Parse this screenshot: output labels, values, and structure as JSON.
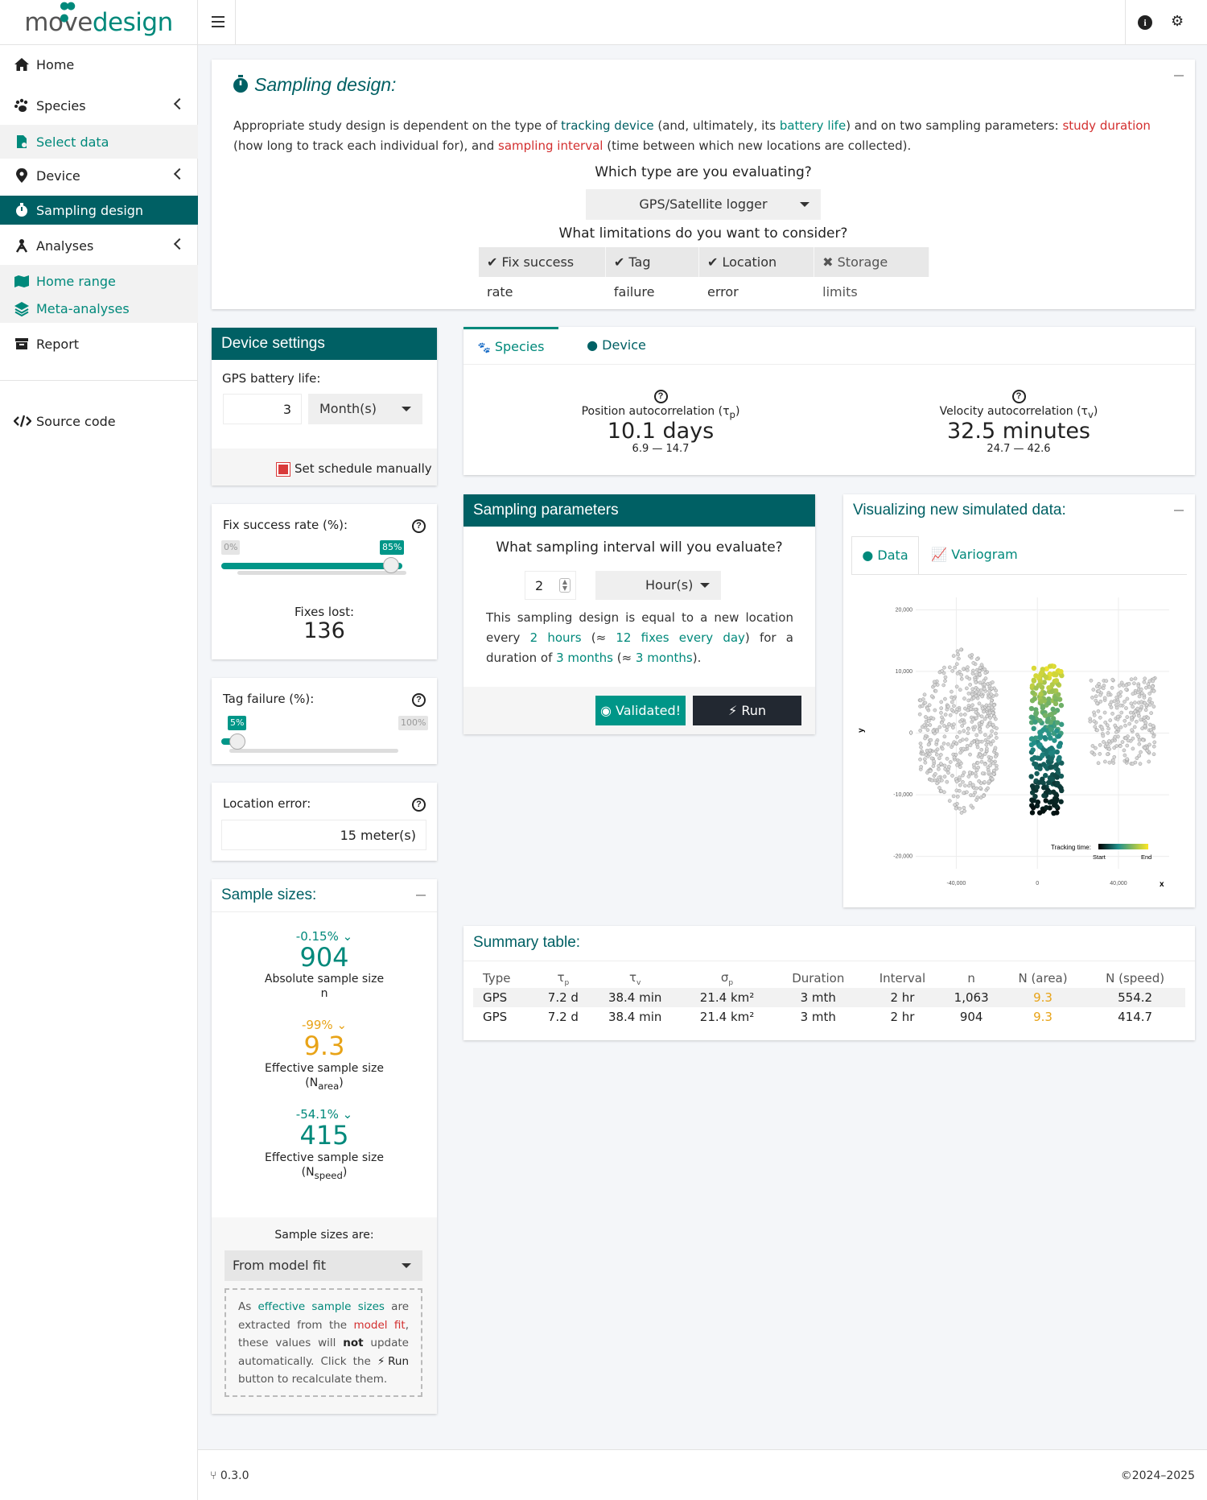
{
  "brand": {
    "part1": "move",
    "part2": "design"
  },
  "sidebar": {
    "home": "Home",
    "species": "Species",
    "select_data": "Select data",
    "device": "Device",
    "sampling_design": "Sampling design",
    "analyses": "Analyses",
    "home_range": "Home range",
    "meta_analyses": "Meta-analyses",
    "report": "Report",
    "source_code": "Source code"
  },
  "intro": {
    "title": "Sampling design:",
    "text1": "Appropriate study design is dependent on the type of ",
    "tracking_device": "tracking device",
    "text2": " (and, ultimately, its ",
    "battery_life": "battery life",
    "text3": ") and on two sampling parameters: ",
    "study_duration": "study duration",
    "text4": " (how long to track each individual for), and ",
    "sampling_interval": "sampling interval",
    "text5": " (time between which new locations are collected).",
    "q_type": "Which type are you evaluating?",
    "type_value": "GPS/Satellite logger",
    "q_limits": "What limitations do you want to consider?",
    "limits": [
      {
        "label": "Fix success rate",
        "mark": "✔"
      },
      {
        "label": "Tag failure",
        "mark": "✔"
      },
      {
        "label": "Location error",
        "mark": "✔"
      },
      {
        "label": "Storage limits",
        "mark": "✖"
      }
    ]
  },
  "device_settings": {
    "title": "Device settings",
    "battery_label": "GPS battery life:",
    "battery_value": "3",
    "battery_unit": "Month(s)",
    "schedule_label": "Set schedule manually"
  },
  "fix_success": {
    "label": "Fix success rate (%):",
    "min": "0%",
    "value": "85%",
    "value_num": 85,
    "fixes_lost_label": "Fixes lost:",
    "fixes_lost": "136"
  },
  "tag_failure": {
    "label": "Tag failure (%):",
    "value": "5%",
    "value_num": 5,
    "max": "100%"
  },
  "location_error": {
    "label": "Location error:",
    "value": "15 meter(s)"
  },
  "sample_sizes": {
    "title": "Sample sizes:",
    "abs_change": "-0.15%",
    "abs_value": "904",
    "abs_label": "Absolute sample size",
    "abs_sym": "n",
    "area_change": "-99%",
    "area_value": "9.3",
    "area_label": "Effective sample size",
    "area_sym": "N",
    "area_sub": "area",
    "speed_change": "-54.1%",
    "speed_value": "415",
    "speed_label": "Effective sample size",
    "speed_sym": "N",
    "speed_sub": "speed",
    "are_label": "Sample sizes are:",
    "are_value": "From model fit",
    "note1": "As ",
    "note_ess": "effective sample sizes",
    "note2": " are extracted from the ",
    "note_model": "model fit",
    "note3": ", these values will ",
    "note_not": "not",
    "note4": " update automatically. Click the ",
    "note_run": "Run",
    "note5": " button to recalculate them."
  },
  "tabs": {
    "species": "Species",
    "device": "Device"
  },
  "autocorr": {
    "pos_label": "Position autocorrelation (τ",
    "pos_sub": "p",
    "pos_close": ")",
    "pos_value": "10.1 days",
    "pos_range": "6.9 — 14.7",
    "vel_label": "Velocity autocorrelation (τ",
    "vel_sub": "v",
    "vel_close": ")",
    "vel_value": "32.5 minutes",
    "vel_range": "24.7 — 42.6"
  },
  "sampling": {
    "title": "Sampling parameters",
    "question": "What sampling interval will you evaluate?",
    "interval_value": "2",
    "interval_unit": "Hour(s)",
    "t1": "This sampling design is equal to a new location every ",
    "every": "2 hours",
    "t2": " (≈ ",
    "fixes": "12 fixes every day",
    "t3": ") for a duration of ",
    "duration": "3 months",
    "t4": " (≈ ",
    "duration2": "3 months",
    "t5": ").",
    "validated": "Validated!",
    "run": "Run"
  },
  "viz": {
    "title": "Visualizing new simulated data:",
    "tab_data": "Data",
    "tab_variogram": "Variogram"
  },
  "chart_data": {
    "type": "scatter",
    "xlabel": "x",
    "ylabel": "y",
    "xticks": [
      "-40,000",
      "0",
      "40,000"
    ],
    "yticks": [
      "20,000",
      "10,000",
      "0",
      "-10,000",
      "-20,000"
    ],
    "xlim": [
      -60000,
      65000
    ],
    "ylim": [
      -22000,
      22000
    ],
    "legend": {
      "title": "Tracking time:",
      "start": "Start",
      "end": "End"
    },
    "colors": {
      "start": "#000000",
      "mid": "#21918c",
      "end": "#fde725",
      "reference": "#9e9e9e"
    },
    "series": [
      {
        "name": "reference",
        "region": "west",
        "x_range": [
          -58000,
          -20000
        ],
        "y_range": [
          -13000,
          14000
        ]
      },
      {
        "name": "reference",
        "region": "east",
        "x_range": [
          26000,
          58000
        ],
        "y_range": [
          -5000,
          9000
        ]
      },
      {
        "name": "simulated",
        "x_range": [
          -3000,
          12000
        ],
        "y_range": [
          -13000,
          11000
        ]
      }
    ]
  },
  "summary": {
    "title": "Summary table:",
    "headers": [
      "Type",
      "τ",
      "τ",
      "σ",
      "Duration",
      "Interval",
      "n",
      "N (area)",
      "N (speed)"
    ],
    "header_subs": [
      "",
      "p",
      "v",
      "p",
      "",
      "",
      "",
      "",
      ""
    ],
    "rows": [
      [
        "GPS",
        "7.2 d",
        "38.4 min",
        "21.4 km²",
        "3 mth",
        "2 hr",
        "1,063",
        "9.3",
        "554.2"
      ],
      [
        "GPS",
        "7.2 d",
        "38.4 min",
        "21.4 km²",
        "3 mth",
        "2 hr",
        "904",
        "9.3",
        "414.7"
      ]
    ]
  },
  "footer": {
    "version": "0.3.0",
    "copyright": "2024–2025"
  }
}
